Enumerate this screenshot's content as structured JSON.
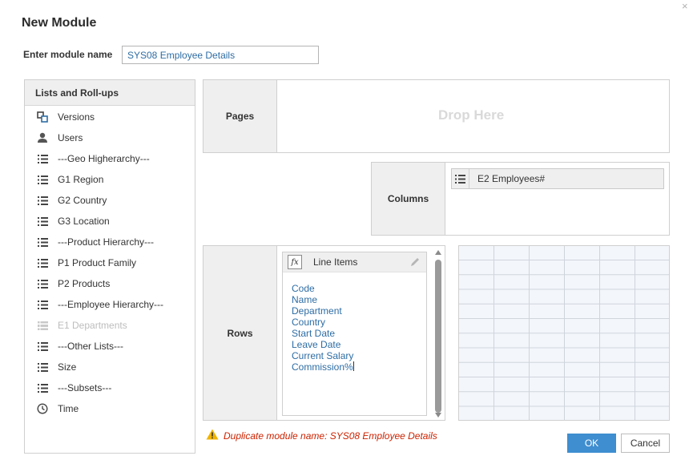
{
  "dialog": {
    "title": "New Module",
    "close_symbol": "×"
  },
  "module_name": {
    "label": "Enter module name",
    "value": "SYS08 Employee Details"
  },
  "lists_panel": {
    "header": "Lists and Roll-ups",
    "items": [
      {
        "label": "Versions",
        "icon": "versions-icon",
        "disabled": false
      },
      {
        "label": "Users",
        "icon": "user-icon",
        "disabled": false
      },
      {
        "label": "---Geo Higherarchy---",
        "icon": "list-icon",
        "disabled": false
      },
      {
        "label": "G1 Region",
        "icon": "list-icon",
        "disabled": false
      },
      {
        "label": "G2 Country",
        "icon": "list-icon",
        "disabled": false
      },
      {
        "label": "G3 Location",
        "icon": "list-icon",
        "disabled": false
      },
      {
        "label": "---Product Hierarchy---",
        "icon": "list-icon",
        "disabled": false
      },
      {
        "label": "P1 Product Family",
        "icon": "list-icon",
        "disabled": false
      },
      {
        "label": "P2 Products",
        "icon": "list-icon",
        "disabled": false
      },
      {
        "label": "---Employee Hierarchy---",
        "icon": "list-icon",
        "disabled": false
      },
      {
        "label": "E1 Departments",
        "icon": "list-icon",
        "disabled": true
      },
      {
        "label": "---Other Lists---",
        "icon": "list-icon",
        "disabled": false
      },
      {
        "label": "Size",
        "icon": "list-icon",
        "disabled": false
      },
      {
        "label": "---Subsets---",
        "icon": "list-icon",
        "disabled": false
      },
      {
        "label": "Time",
        "icon": "clock-icon",
        "disabled": false
      }
    ]
  },
  "pages": {
    "label": "Pages",
    "placeholder": "Drop Here"
  },
  "columns": {
    "label": "Columns",
    "chip": "E2 Employees#"
  },
  "rows": {
    "label": "Rows",
    "line_items_title": "Line Items",
    "line_items": [
      "Code",
      "Name",
      "Department",
      "Country",
      "Start Date",
      "Leave Date",
      "Current Salary",
      "Commission%"
    ]
  },
  "warning": {
    "text": "Duplicate module name: SYS08 Employee Details"
  },
  "buttons": {
    "ok": "OK",
    "cancel": "Cancel"
  },
  "colors": {
    "accent": "#3e8ed0",
    "link": "#2e6da4",
    "error": "#cc2200",
    "warning_icon": "#f0b400"
  }
}
